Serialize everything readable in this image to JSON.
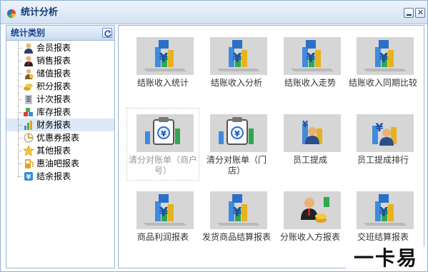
{
  "window": {
    "title": "统计分析"
  },
  "sidebar": {
    "title": "统计类别",
    "items": [
      {
        "label": "会员报表",
        "icon": "member-icon"
      },
      {
        "label": "销售报表",
        "icon": "sales-icon"
      },
      {
        "label": "储值报表",
        "icon": "stored-value-icon"
      },
      {
        "label": "积分报表",
        "icon": "points-icon"
      },
      {
        "label": "计次报表",
        "icon": "count-icon"
      },
      {
        "label": "库存报表",
        "icon": "inventory-icon"
      },
      {
        "label": "财务报表",
        "icon": "finance-icon",
        "selected": true
      },
      {
        "label": "优惠券报表",
        "icon": "coupon-icon"
      },
      {
        "label": "其他报表",
        "icon": "star-icon"
      },
      {
        "label": "惠油吧报表",
        "icon": "fuel-icon"
      },
      {
        "label": "结余报表",
        "icon": "balance-icon"
      }
    ]
  },
  "tiles": [
    {
      "label": "结账收入统计",
      "icon": "yen-chart-icon"
    },
    {
      "label": "结账收入分析",
      "icon": "yen-chart-icon"
    },
    {
      "label": "结账收入走势",
      "icon": "yen-chart-icon"
    },
    {
      "label": "结账收入同期比较",
      "icon": "yen-chart-icon"
    },
    {
      "label": "清分对账单（商户号）",
      "icon": "reconcile-icon",
      "selected": true
    },
    {
      "label": "清分对账单（门店）",
      "icon": "reconcile-icon"
    },
    {
      "label": "员工提成",
      "icon": "staff-commission-icon"
    },
    {
      "label": "员工提成排行",
      "icon": "yen-staff-icon"
    },
    {
      "label": "商品利润报表",
      "icon": "yen-chart-icon"
    },
    {
      "label": "发货商品结算报表",
      "icon": "yen-chart-icon"
    },
    {
      "label": "分账收入方报表",
      "icon": "staff-coins-icon"
    },
    {
      "label": "交班结算报表",
      "icon": "yen-chart-icon"
    }
  ],
  "watermark": "一卡易",
  "colors": {
    "title_text": "#123a73",
    "sidebar_header_text": "#15428b",
    "selected_row": "#dde9f8",
    "tile_bg": "#d6d6d6"
  }
}
